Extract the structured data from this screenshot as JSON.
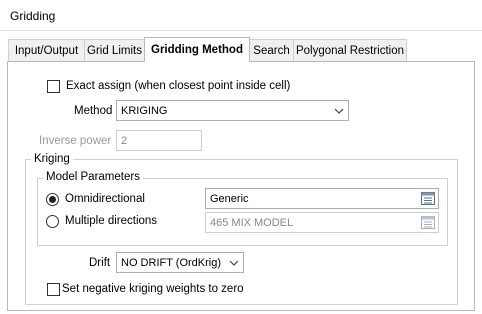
{
  "window": {
    "title": "Gridding"
  },
  "tabs": [
    {
      "label": "Input/Output"
    },
    {
      "label": "Grid Limits"
    },
    {
      "label": "Gridding Method"
    },
    {
      "label": "Search"
    },
    {
      "label": "Polygonal Restriction"
    }
  ],
  "active_tab": "Gridding Method",
  "form": {
    "exact_assign_label": "Exact assign (when closest point inside cell)",
    "exact_assign_checked": false,
    "method_label": "Method",
    "method_value": "KRIGING",
    "inverse_power_label": "Inverse power",
    "inverse_power_value": "2"
  },
  "kriging": {
    "group_label": "Kriging",
    "model_params_label": "Model Parameters",
    "omni_label": "Omnidirectional",
    "omni_selected": true,
    "omni_value": "Generic",
    "multi_label": "Multiple directions",
    "multi_selected": false,
    "multi_value": "465 MIX MODEL",
    "drift_label": "Drift",
    "drift_value": "NO DRIFT (OrdKrig)",
    "negative_weights_label": "Set negative kriging weights to zero",
    "negative_weights_checked": false
  }
}
